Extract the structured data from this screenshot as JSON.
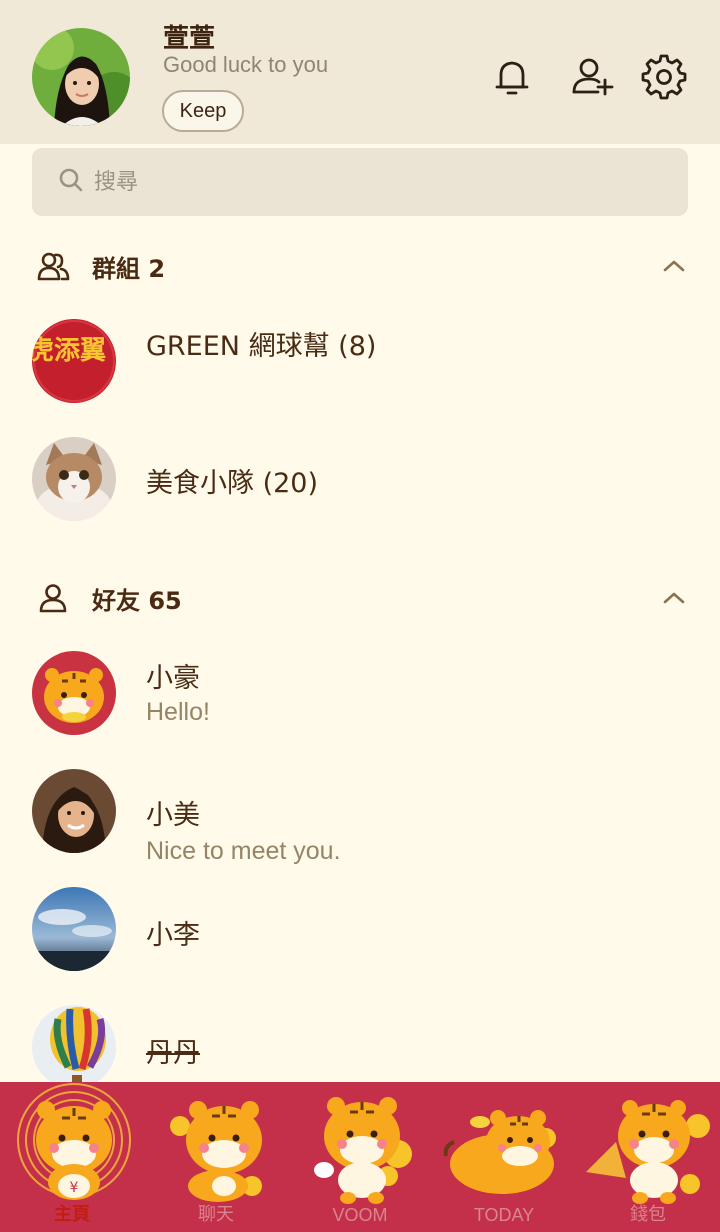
{
  "profile": {
    "name": "萱萱",
    "status": "Good luck to you",
    "keep_label": "Keep"
  },
  "header_icons": [
    "bell-icon",
    "add-friend-icon",
    "settings-gear-icon"
  ],
  "search": {
    "placeholder": "搜尋"
  },
  "groups": {
    "title": "群組 2",
    "items": [
      {
        "name": "GREEN 網球幫 (8)",
        "avatar": "red-chinese-characters-avatar",
        "avatar_text": "如虎添翼"
      },
      {
        "name": "美食小隊 (20)",
        "avatar": "cat-photo-avatar"
      }
    ]
  },
  "friends": {
    "title": "好友 65",
    "items": [
      {
        "name": "小豪",
        "message": "Hello!",
        "avatar": "tiger-sticker-avatar"
      },
      {
        "name": "小美",
        "message": "Nice to meet you.",
        "avatar": "woman-photo-avatar"
      },
      {
        "name": "小李",
        "message": "",
        "avatar": "sky-photo-avatar"
      },
      {
        "name": "丹丹",
        "message": "",
        "avatar": "hot-air-balloon-avatar"
      }
    ]
  },
  "nav": {
    "items": [
      {
        "label": "主頁",
        "active": true
      },
      {
        "label": "聊天",
        "active": false
      },
      {
        "label": "VOOM",
        "active": false
      },
      {
        "label": "TODAY",
        "active": false
      },
      {
        "label": "錢包",
        "active": false
      }
    ]
  },
  "colors": {
    "header_bg": "#f1e9d8",
    "page_bg": "#fffaea",
    "nav_bg": "#c4304a",
    "active_label": "#c21d12",
    "tiger_orange": "#f7a81c"
  }
}
